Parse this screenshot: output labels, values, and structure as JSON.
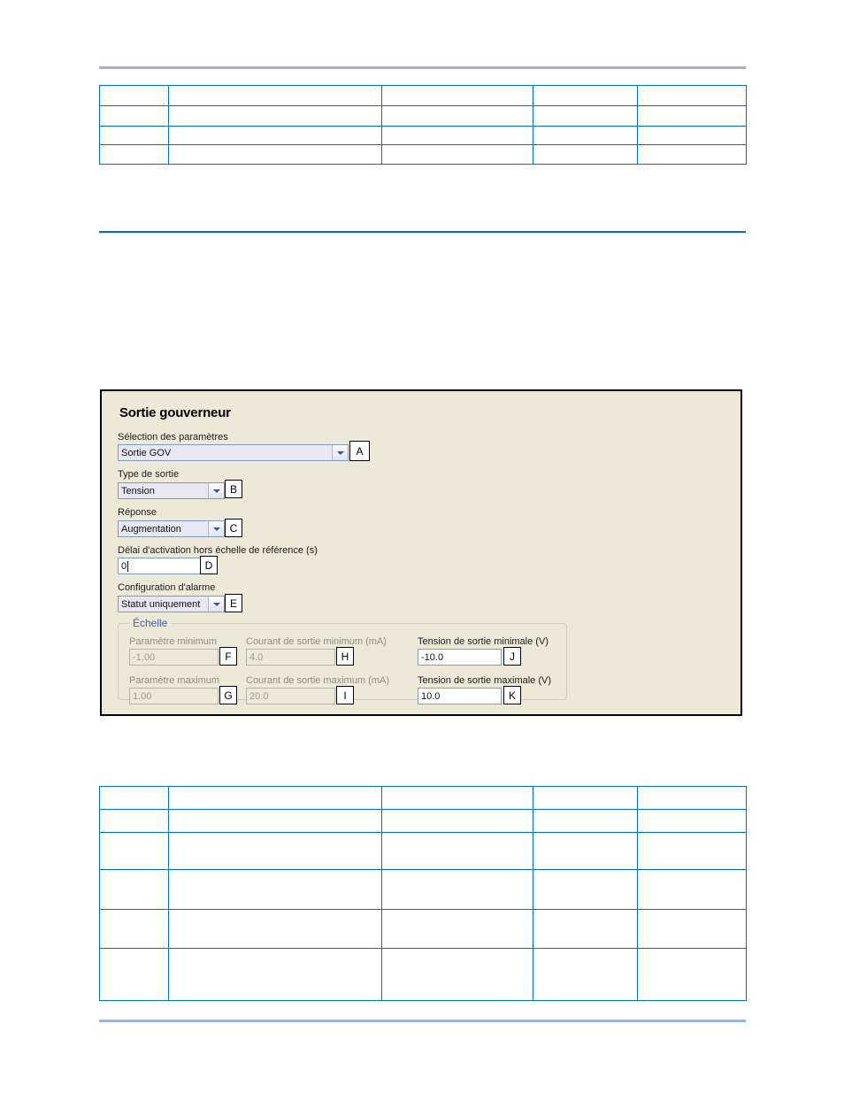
{
  "page": {
    "rules": {
      "top_color": "#9bb3d4",
      "middle_color": "#0070c0",
      "bottom_color": "#9bb3d4"
    },
    "tables": {
      "border_color": "#0070c0",
      "top": {
        "columns": [
          "",
          "",
          "",
          "",
          ""
        ],
        "rows": [
          [
            "",
            "",
            "",
            "",
            ""
          ],
          [
            "",
            "",
            "",
            "",
            ""
          ],
          [
            "",
            "",
            "",
            "",
            ""
          ],
          [
            "",
            "",
            "",
            "",
            ""
          ]
        ]
      },
      "bottom": {
        "columns": [
          "",
          "",
          "",
          "",
          ""
        ],
        "rows": [
          [
            "",
            "",
            "",
            "",
            ""
          ],
          [
            "",
            "",
            "",
            "",
            ""
          ],
          [
            "",
            "",
            "",
            "",
            ""
          ],
          [
            "",
            "",
            "",
            "",
            ""
          ],
          [
            "",
            "",
            "",
            "",
            ""
          ],
          [
            "",
            "",
            "",
            "",
            ""
          ]
        ]
      }
    }
  },
  "dialog": {
    "title": "Sortie gouverneur",
    "background_color": "#ece9d8",
    "fields": {
      "parameter_selection": {
        "label": "Sélection des paramètres",
        "value": "Sortie GOV",
        "callout": "A"
      },
      "output_type": {
        "label": "Type de sortie",
        "value": "Tension",
        "callout": "B"
      },
      "response": {
        "label": "Réponse",
        "value": "Augmentation",
        "callout": "C"
      },
      "activation_delay": {
        "label": "Délai d'activation hors échelle de référence (s)",
        "value": "0",
        "callout": "D"
      },
      "alarm_configuration": {
        "label": "Configuration d'alarme",
        "value": "Statut uniquement",
        "callout": "E"
      }
    },
    "scale_group": {
      "title": "Échelle",
      "title_color": "#3a5fb5",
      "fields": {
        "min_parameter": {
          "label": "Paramètre minimum",
          "value": "-1.00",
          "callout": "F",
          "enabled": false
        },
        "max_parameter": {
          "label": "Paramètre maximum",
          "value": "1.00",
          "callout": "G",
          "enabled": false
        },
        "min_output_current": {
          "label": "Courant de sortie minimum (mA)",
          "value": "4.0",
          "callout": "H",
          "enabled": false
        },
        "max_output_current": {
          "label": "Courant de sortie maximum (mA)",
          "value": "20.0",
          "callout": "I",
          "enabled": false
        },
        "min_output_voltage": {
          "label": "Tension de sortie minimale (V)",
          "value": "-10.0",
          "callout": "J",
          "enabled": true
        },
        "max_output_voltage": {
          "label": "Tension de sortie maximale (V)",
          "value": "10.0",
          "callout": "K",
          "enabled": true
        }
      }
    }
  }
}
